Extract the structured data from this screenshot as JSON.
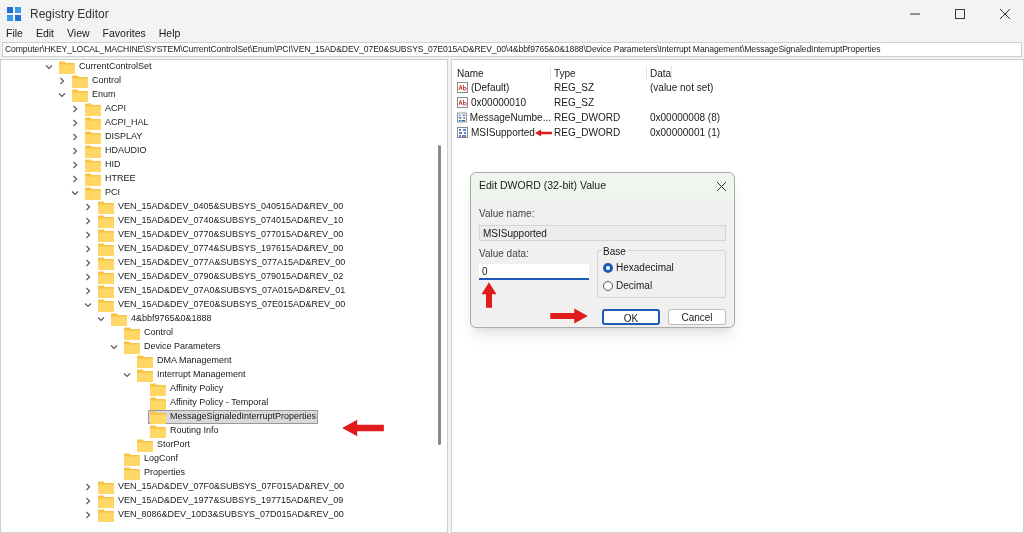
{
  "window": {
    "title": "Registry Editor"
  },
  "menu": [
    "File",
    "Edit",
    "View",
    "Favorites",
    "Help"
  ],
  "address": "Computer\\HKEY_LOCAL_MACHINE\\SYSTEM\\CurrentControlSet\\Enum\\PCI\\VEN_15AD&DEV_07E0&SUBSYS_07E015AD&REV_00\\4&bbf9765&0&1888\\Device Parameters\\Interrupt Management\\MessageSignaledInterruptProperties",
  "tree": [
    {
      "label": "CurrentControlSet",
      "expanded": true,
      "selected": false,
      "children": [
        {
          "label": "Control",
          "expanded": false,
          "selected": false
        },
        {
          "label": "Enum",
          "expanded": true,
          "selected": false,
          "children": [
            {
              "label": "ACPI",
              "expanded": false,
              "selected": false
            },
            {
              "label": "ACPI_HAL",
              "expanded": false,
              "selected": false
            },
            {
              "label": "DISPLAY",
              "expanded": false,
              "selected": false
            },
            {
              "label": "HDAUDIO",
              "expanded": false,
              "selected": false
            },
            {
              "label": "HID",
              "expanded": false,
              "selected": false
            },
            {
              "label": "HTREE",
              "expanded": false,
              "selected": false
            },
            {
              "label": "PCI",
              "expanded": true,
              "selected": false,
              "children": [
                {
                  "label": "VEN_15AD&DEV_0405&SUBSYS_040515AD&REV_00",
                  "expanded": false,
                  "selected": false
                },
                {
                  "label": "VEN_15AD&DEV_0740&SUBSYS_074015AD&REV_10",
                  "expanded": false,
                  "selected": false
                },
                {
                  "label": "VEN_15AD&DEV_0770&SUBSYS_077015AD&REV_00",
                  "expanded": false,
                  "selected": false
                },
                {
                  "label": "VEN_15AD&DEV_0774&SUBSYS_197615AD&REV_00",
                  "expanded": false,
                  "selected": false
                },
                {
                  "label": "VEN_15AD&DEV_077A&SUBSYS_077A15AD&REV_00",
                  "expanded": false,
                  "selected": false
                },
                {
                  "label": "VEN_15AD&DEV_0790&SUBSYS_079015AD&REV_02",
                  "expanded": false,
                  "selected": false
                },
                {
                  "label": "VEN_15AD&DEV_07A0&SUBSYS_07A015AD&REV_01",
                  "expanded": false,
                  "selected": false
                },
                {
                  "label": "VEN_15AD&DEV_07E0&SUBSYS_07E015AD&REV_00",
                  "expanded": true,
                  "selected": false,
                  "children": [
                    {
                      "label": "4&bbf9765&0&1888",
                      "expanded": true,
                      "selected": false,
                      "children": [
                        {
                          "label": "Control",
                          "selected": false
                        },
                        {
                          "label": "Device Parameters",
                          "expanded": true,
                          "selected": false,
                          "children": [
                            {
                              "label": "DMA Management",
                              "selected": false
                            },
                            {
                              "label": "Interrupt Management",
                              "expanded": true,
                              "selected": false,
                              "children": [
                                {
                                  "label": "Affinity Policy",
                                  "selected": false
                                },
                                {
                                  "label": "Affinity Policy - Temporal",
                                  "selected": false
                                },
                                {
                                  "label": "MessageSignaledInterruptProperties",
                                  "selected": true
                                },
                                {
                                  "label": "Routing Info",
                                  "selected": false
                                }
                              ]
                            },
                            {
                              "label": "StorPort",
                              "selected": false
                            }
                          ]
                        },
                        {
                          "label": "LogConf",
                          "selected": false
                        },
                        {
                          "label": "Properties",
                          "selected": false
                        }
                      ]
                    }
                  ]
                },
                {
                  "label": "VEN_15AD&DEV_07F0&SUBSYS_07F015AD&REV_00",
                  "expanded": false,
                  "selected": false
                },
                {
                  "label": "VEN_15AD&DEV_1977&SUBSYS_197715AD&REV_09",
                  "expanded": false,
                  "selected": false
                },
                {
                  "label": "VEN_8086&DEV_10D3&SUBSYS_07D015AD&REV_00",
                  "expanded": false,
                  "selected": false
                }
              ]
            }
          ]
        }
      ]
    }
  ],
  "values": {
    "columns": [
      "Name",
      "Type",
      "Data"
    ],
    "rows": [
      {
        "kind": "string",
        "name": "(Default)",
        "type": "REG_SZ",
        "data": "(value not set)"
      },
      {
        "kind": "string",
        "name": "0x00000010",
        "type": "REG_SZ"
      },
      {
        "kind": "binary",
        "name": "MessageNumbe...",
        "type": "REG_DWORD",
        "data": "0x00000008 (8)"
      },
      {
        "kind": "binary",
        "name": "MSISupported",
        "type": "REG_DWORD",
        "data": "0x00000001 (1)"
      }
    ]
  },
  "dialog": {
    "title": "Edit DWORD (32-bit) Value",
    "name_label": "Value name:",
    "name_value": "MSISupported",
    "data_label": "Value data:",
    "data_value": "0",
    "base_label": "Base",
    "bases": [
      {
        "label": "Hexadecimal",
        "selected": true
      },
      {
        "label": "Decimal",
        "selected": false
      }
    ],
    "buttons": [
      {
        "label": "OK",
        "default": true
      },
      {
        "label": "Cancel",
        "default": false
      }
    ]
  }
}
